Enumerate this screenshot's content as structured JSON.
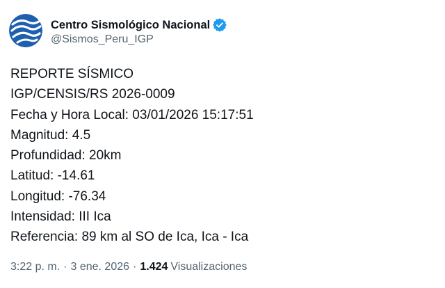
{
  "account": {
    "display_name": "Centro Sismológico Nacional",
    "handle": "@Sismos_Peru_IGP",
    "verified_icon": "verified-badge-icon",
    "avatar_icon": "seismic-logo-icon"
  },
  "tweet": {
    "lines": [
      "REPORTE SÍSMICO",
      "IGP/CENSIS/RS 2026-0009",
      "Fecha y Hora Local: 03/01/2026 15:17:51",
      "Magnitud: 4.5",
      "Profundidad: 20km",
      "Latitud: -14.61",
      "Longitud: -76.34",
      "Intensidad: III Ica",
      "Referencia: 89 km al SO de Ica, Ica - Ica"
    ]
  },
  "meta": {
    "time": "3:22 p. m.",
    "separator_1": "·",
    "date": "3 ene. 2026",
    "separator_2": "·",
    "views_count": "1.424",
    "views_label": "Visualizaciones"
  },
  "colors": {
    "avatar_blue": "#1f5fb0",
    "verified_blue": "#1d9bf0",
    "text_primary": "#0f1419",
    "text_secondary": "#536471"
  }
}
